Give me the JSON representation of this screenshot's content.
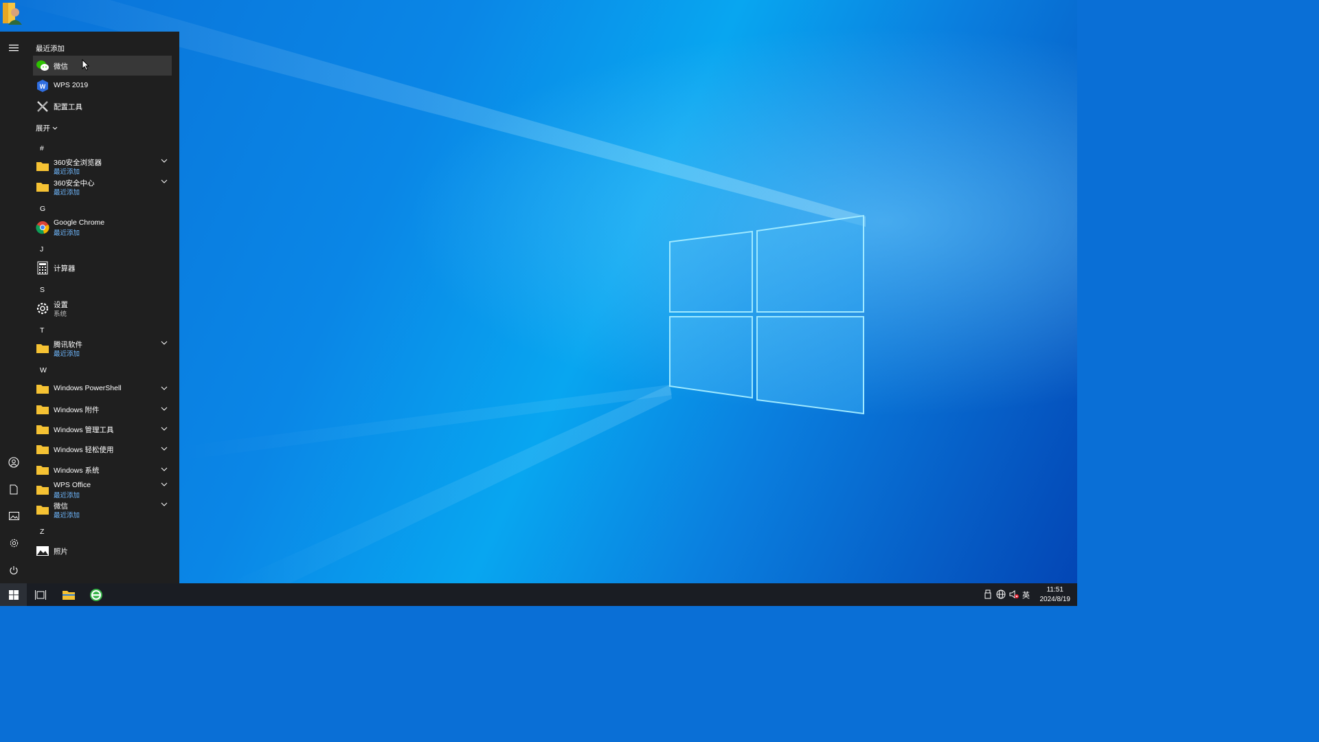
{
  "desktop": {
    "icon": "user-folder-icon",
    "colors": {
      "accent": "#0a86e6",
      "logo_glow": "#8fe4ff"
    }
  },
  "start_menu": {
    "rail": [
      {
        "icon": "hamburger-icon"
      },
      {
        "icon": "user-icon"
      },
      {
        "icon": "document-icon"
      },
      {
        "icon": "pictures-icon"
      },
      {
        "icon": "settings-icon"
      },
      {
        "icon": "power-icon"
      }
    ],
    "recent_header": "最近添加",
    "recent": [
      {
        "label": "微信",
        "icon": "wechat-icon"
      },
      {
        "label": "WPS 2019",
        "icon": "wps-icon"
      },
      {
        "label": "配置工具",
        "icon": "tools-icon"
      }
    ],
    "expand_label": "展开",
    "letters": {
      "hash": "#",
      "g": "G",
      "j": "J",
      "s": "S",
      "t": "T",
      "w": "W",
      "z": "Z"
    },
    "apps": {
      "a360_browser": {
        "label": "360安全浏览器",
        "sub": "最近添加"
      },
      "a360_center": {
        "label": "360安全中心",
        "sub": "最近添加"
      },
      "chrome": {
        "label": "Google Chrome",
        "sub": "最近添加"
      },
      "calculator": {
        "label": "计算器"
      },
      "settings": {
        "label": "设置",
        "sub": "系统"
      },
      "tencent": {
        "label": "腾讯软件",
        "sub": "最近添加"
      },
      "powershell": {
        "label": "Windows PowerShell"
      },
      "accessories": {
        "label": "Windows 附件"
      },
      "admin_tools": {
        "label": "Windows 管理工具"
      },
      "ease": {
        "label": "Windows 轻松使用"
      },
      "system": {
        "label": "Windows 系统"
      },
      "wps_office": {
        "label": "WPS Office",
        "sub": "最近添加"
      },
      "wechat_folder": {
        "label": "微信",
        "sub": "最近添加"
      },
      "photos": {
        "label": "照片"
      }
    }
  },
  "taskbar": {
    "items": [
      "windows-start-icon",
      "task-view-icon",
      "file-explorer-icon",
      "browser-360-icon"
    ],
    "tray": [
      "usb-icon",
      "network-icon",
      "volume-muted-icon"
    ],
    "lang": "英",
    "time": "11:51",
    "date": "2024/8/19"
  }
}
